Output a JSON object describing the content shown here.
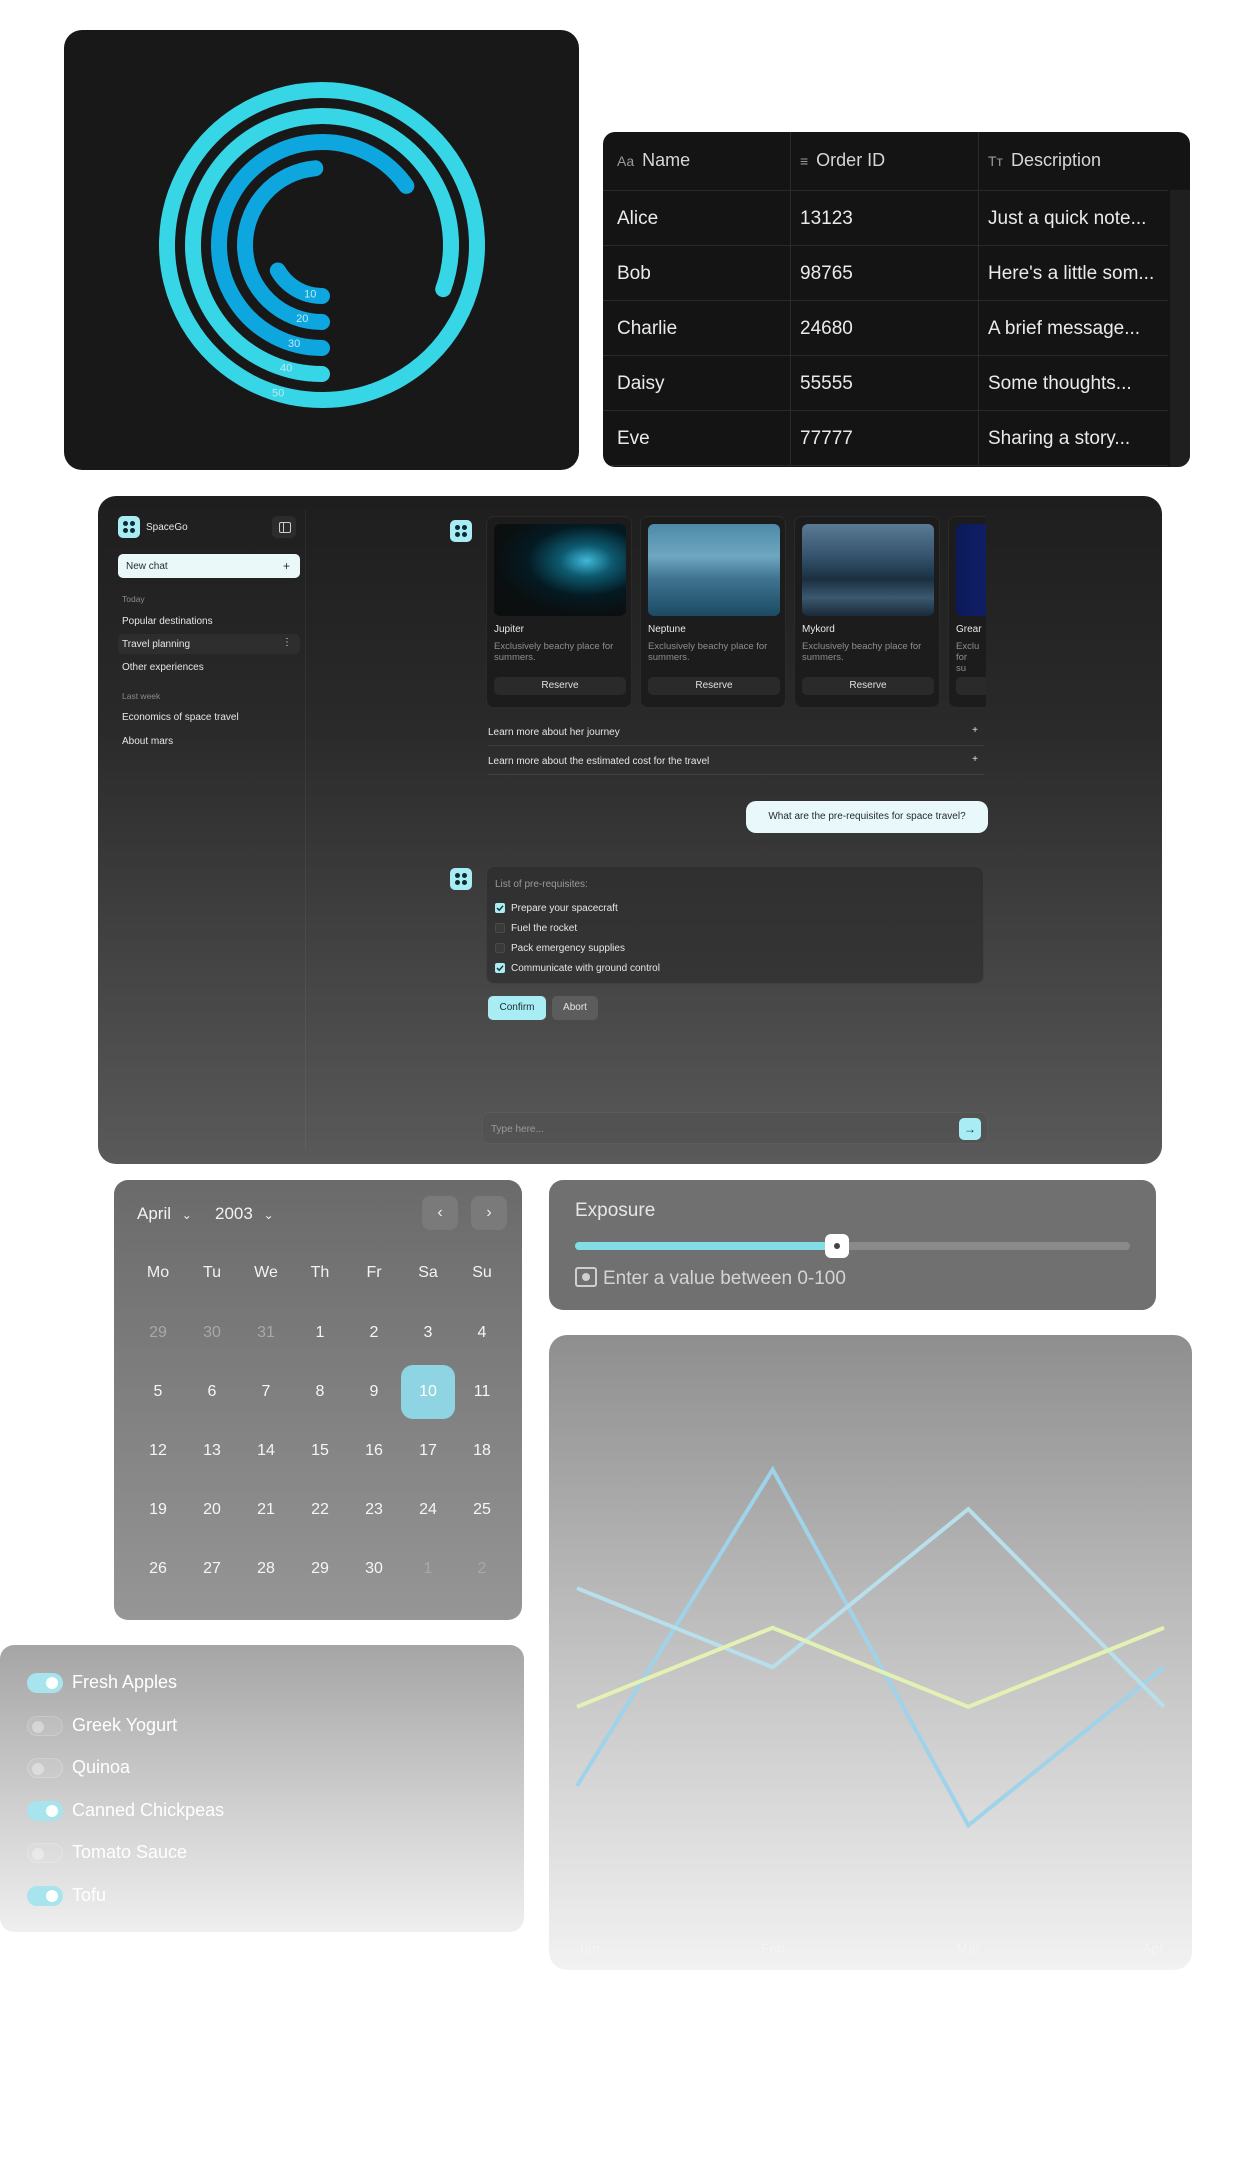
{
  "radial": {
    "labels": [
      "10",
      "20",
      "30",
      "40",
      "50"
    ],
    "colors": {
      "outer": "#36d6e6",
      "inner": "#0ea6df"
    }
  },
  "table": {
    "headers": [
      {
        "icon": "Aa",
        "label": "Name"
      },
      {
        "icon": "≡",
        "label": "Order ID"
      },
      {
        "icon": "Tт",
        "label": "Description"
      }
    ],
    "rows": [
      [
        "Alice",
        "13123",
        "Just a quick note..."
      ],
      [
        "Bob",
        "98765",
        "Here's a little som..."
      ],
      [
        "Charlie",
        "24680",
        "A brief message..."
      ],
      [
        "Daisy",
        "55555",
        "Some thoughts..."
      ],
      [
        "Eve",
        "77777",
        "Sharing a story..."
      ]
    ]
  },
  "chat": {
    "app_name": "SpaceGo",
    "new_chat": "New chat",
    "new_chat_icon": "+",
    "today_label": "Today",
    "today_items": [
      "Popular destinations",
      "Travel planning",
      "Other experiences"
    ],
    "last_week_label": "Last week",
    "last_week_items": [
      "Economics of space travel",
      "About mars"
    ],
    "cards": [
      {
        "title": "Jupiter",
        "desc": "Exclusively beachy place for summers.",
        "button": "Reserve"
      },
      {
        "title": "Neptune",
        "desc": "Exclusively beachy place for summers.",
        "button": "Reserve"
      },
      {
        "title": "Mykord",
        "desc": "Exclusively beachy place for summers.",
        "button": "Reserve"
      },
      {
        "title": "Grear",
        "desc": "Exclu for su",
        "button": ""
      }
    ],
    "accordion": [
      {
        "label": "Learn more about her journey",
        "icon": "+"
      },
      {
        "label": "Learn more about the estimated cost for the travel",
        "icon": "+"
      }
    ],
    "user_message": "What are the pre-requisites for space travel?",
    "todo_title": "List of pre-requisites:",
    "todos": [
      {
        "label": "Prepare your spacecraft",
        "checked": true
      },
      {
        "label": "Fuel the rocket",
        "checked": false
      },
      {
        "label": "Pack emergency supplies",
        "checked": false
      },
      {
        "label": "Communicate with ground control",
        "checked": true
      }
    ],
    "confirm": "Confirm",
    "abort": "Abort",
    "input_placeholder": "Type here...",
    "send_icon": "→"
  },
  "calendar": {
    "month": "April",
    "year": "2003",
    "dow": [
      "Mo",
      "Tu",
      "We",
      "Th",
      "Fr",
      "Sa",
      "Su"
    ],
    "weeks": [
      [
        "29",
        "30",
        "31",
        "1",
        "2",
        "3",
        "4"
      ],
      [
        "5",
        "6",
        "7",
        "8",
        "9",
        "10",
        "11"
      ],
      [
        "12",
        "13",
        "14",
        "15",
        "16",
        "17",
        "18"
      ],
      [
        "19",
        "20",
        "21",
        "22",
        "23",
        "24",
        "25"
      ],
      [
        "26",
        "27",
        "28",
        "29",
        "30",
        "1",
        "2"
      ]
    ],
    "selected": "10",
    "prev_icon": "‹",
    "next_icon": "›"
  },
  "exposure": {
    "label": "Exposure",
    "value_fraction": 0.45,
    "placeholder": "Enter a value between 0-100"
  },
  "chart_data": {
    "type": "line",
    "categories": [
      "Jan",
      "Feb",
      "Mar",
      "Apr"
    ],
    "series": [
      {
        "values": [
          20,
          100,
          10,
          50
        ],
        "color": "#9ed3ea"
      },
      {
        "values": [
          70,
          50,
          90,
          40
        ],
        "color": "#b7e0ec"
      },
      {
        "values": [
          40,
          60,
          40,
          60
        ],
        "color": "#e3f2b4"
      }
    ],
    "ylim": [
      0,
      110
    ],
    "grid": false
  },
  "toggles": [
    {
      "label": "Fresh Apples",
      "on": true
    },
    {
      "label": "Greek Yogurt",
      "on": false
    },
    {
      "label": "Quinoa",
      "on": false
    },
    {
      "label": "Canned Chickpeas",
      "on": true
    },
    {
      "label": "Tomato Sauce",
      "on": false
    },
    {
      "label": "Tofu",
      "on": true
    }
  ]
}
